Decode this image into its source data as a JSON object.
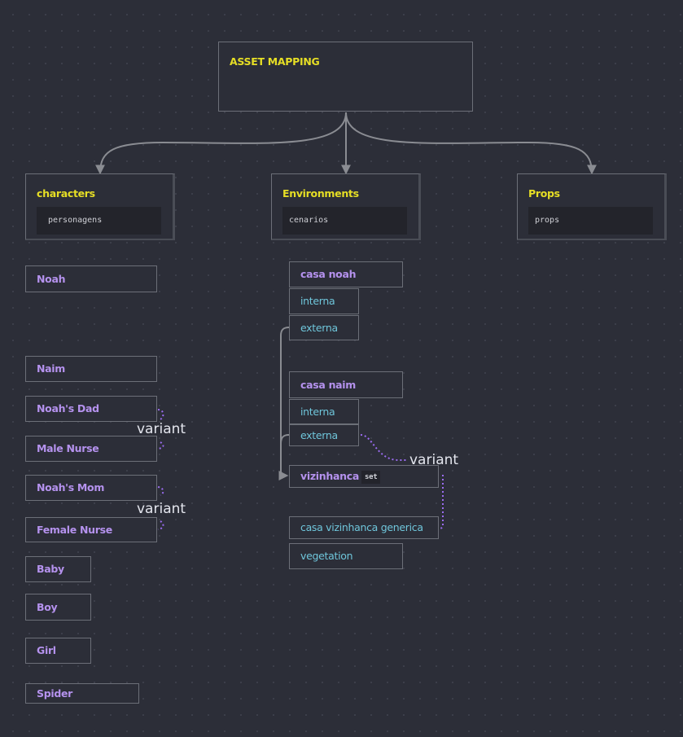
{
  "root": {
    "title": "ASSET MAPPING"
  },
  "categories": [
    {
      "title": "characters",
      "code": "personagens"
    },
    {
      "title": "Environments",
      "code": "cenarios"
    },
    {
      "title": "Props",
      "code": "props"
    }
  ],
  "characters": [
    "Noah",
    "Naim",
    "Noah's Dad",
    "Male Nurse",
    "Noah's Mom",
    "Female Nurse",
    "Baby",
    "Boy",
    "Girl",
    "Spider"
  ],
  "environments": {
    "casa_noah": {
      "label": "casa noah",
      "children": [
        "interna",
        "externa"
      ]
    },
    "casa_naim": {
      "label": "casa naim",
      "children": [
        "interna",
        "externa"
      ]
    },
    "vizinhanca": {
      "label": "vizinhanca",
      "tag": "set"
    },
    "generic": [
      "casa vizinhanca generica",
      "vegetation"
    ]
  },
  "relations": {
    "variant_label": "variant"
  },
  "colors": {
    "background": "#2c2e38",
    "title": "#e6de25",
    "asset_name": "#b592ee",
    "sub_item": "#6fc6db",
    "variant_link": "#9b6cf0",
    "connector": "#8a8c92"
  }
}
